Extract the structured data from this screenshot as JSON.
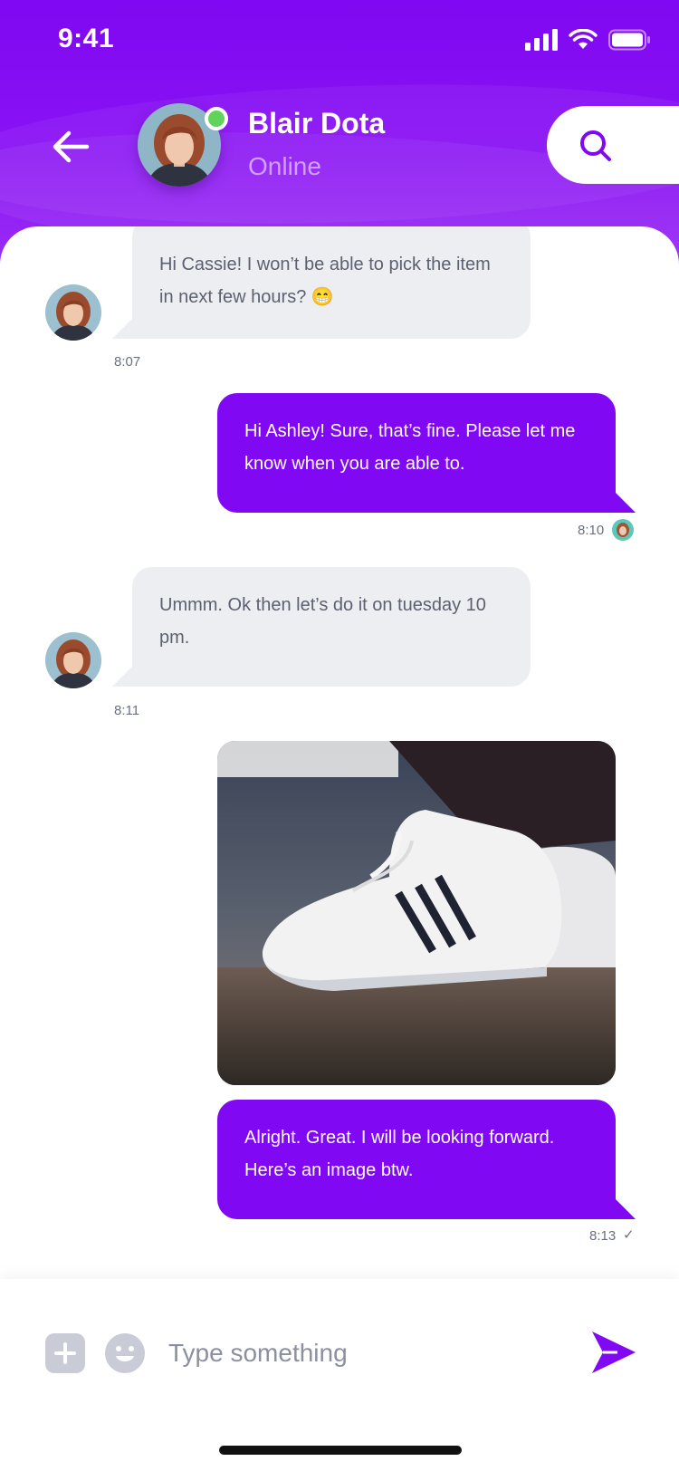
{
  "status_bar": {
    "time": "9:41"
  },
  "header": {
    "contact_name": "Blair Dota",
    "contact_status": "Online",
    "icons": {
      "back": "arrow-left-icon",
      "search": "search-icon"
    }
  },
  "messages": [
    {
      "direction": "in",
      "text": "Hi Cassie! I won’t be able to pick the item in next few hours? 😁",
      "time": "8:07"
    },
    {
      "direction": "out",
      "text": "Hi Ashley! Sure, that’s fine. Please let me know when you are able to.",
      "time": "8:10"
    },
    {
      "direction": "in",
      "text": "Ummm. Ok then let’s do it on tuesday 10 pm.",
      "time": "8:11"
    },
    {
      "direction": "out",
      "type": "image",
      "image": "white-high-top-sneakers-photo"
    },
    {
      "direction": "out",
      "text": "Alright. Great. I will be looking forward. Here’s an image btw.",
      "time": "8:13",
      "read_mark": "✓"
    }
  ],
  "input": {
    "placeholder": "Type something"
  },
  "colors": {
    "primary": "#8008f2",
    "bubble_in": "#eceef2",
    "online": "#5fd35a",
    "text_muted": "#5b6170"
  }
}
